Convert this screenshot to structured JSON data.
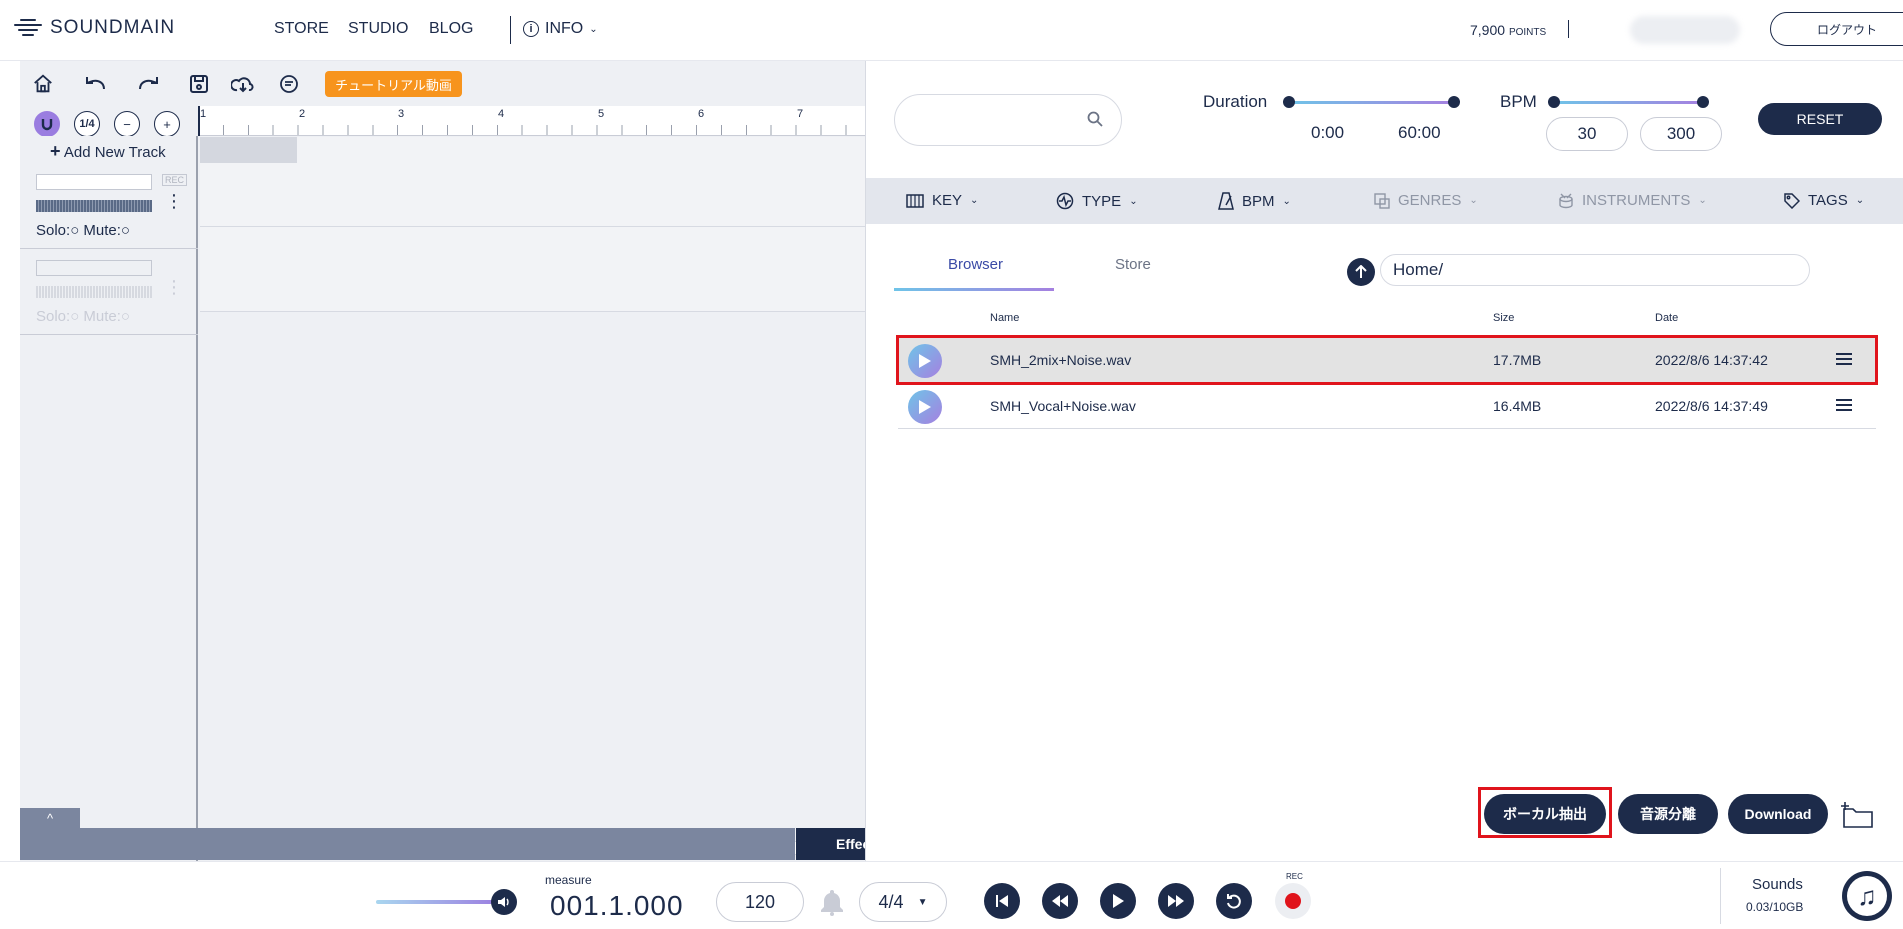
{
  "header": {
    "logo": "SOUNDMAIN",
    "nav": [
      "STORE",
      "STUDIO",
      "BLOG"
    ],
    "info": "INFO",
    "points_value": "7,900",
    "points_unit": "POINTS",
    "logout": "ログアウト"
  },
  "editor": {
    "tutorial_button": "チュートリアル動画",
    "quantize": "1/4",
    "ruler_numbers": [
      "1",
      "2",
      "3",
      "4",
      "5",
      "6",
      "7"
    ],
    "add_track": "Add New Track",
    "tracks": [
      {
        "rec": "REC",
        "solo_mute": "Solo:○ Mute:○"
      },
      {
        "rec": "",
        "solo_mute": "Solo:○ Mute:○"
      }
    ],
    "bottom_tab": "^",
    "effect": "Effect"
  },
  "browser_panel": {
    "duration_label": "Duration",
    "duration_min": "0:00",
    "duration_max": "60:00",
    "bpm_label": "BPM",
    "bpm_min": "30",
    "bpm_max": "300",
    "reset": "RESET",
    "filters": [
      {
        "label": "KEY",
        "icon": "piano-icon"
      },
      {
        "label": "TYPE",
        "icon": "pulse-icon"
      },
      {
        "label": "BPM",
        "icon": "metronome-icon"
      },
      {
        "label": "GENRES",
        "icon": "genre-icon"
      },
      {
        "label": "INSTRUMENTS",
        "icon": "drum-icon"
      },
      {
        "label": "TAGS",
        "icon": "tag-icon"
      }
    ],
    "tabs": [
      "Browser",
      "Store"
    ],
    "path": "Home/",
    "columns": {
      "name": "Name",
      "size": "Size",
      "date": "Date"
    },
    "files": [
      {
        "name": "SMH_2mix+Noise.wav",
        "size": "17.7MB",
        "date": "2022/8/6 14:37:42",
        "selected": true
      },
      {
        "name": "SMH_Vocal+Noise.wav",
        "size": "16.4MB",
        "date": "2022/8/6 14:37:49",
        "selected": false
      }
    ],
    "actions": {
      "vocal_extract": "ボーカル抽出",
      "separate": "音源分離",
      "download": "Download"
    }
  },
  "transport": {
    "measure_label": "measure",
    "measure_value": "001.1.000",
    "tempo": "120",
    "time_signature": "4/4",
    "rec_label": "REC",
    "sounds_label": "Sounds",
    "sounds_value": "0.03/10GB"
  },
  "colors": {
    "navy": "#1d2b4a",
    "accent_orange": "#f7941d",
    "highlight_red": "#e0141c",
    "gradient_start": "#6fc4e8",
    "gradient_end": "#a580e0"
  }
}
